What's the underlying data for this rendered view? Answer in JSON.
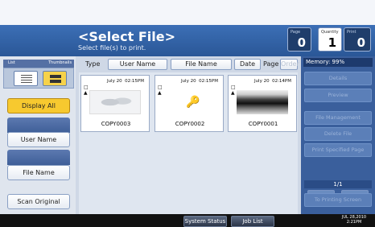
{
  "header": {
    "title": "<Select File>",
    "subtitle": "Select file(s) to print."
  },
  "counters": [
    {
      "label": "Page",
      "value": "0"
    },
    {
      "label": "Quantity",
      "value": "1"
    },
    {
      "label": "Print",
      "value": "0"
    }
  ],
  "view": {
    "list_label": "List",
    "thumbnails_label": "Thumbnails"
  },
  "sidebar": {
    "display_all": "Display All",
    "user_name": "User Name",
    "file_name": "File Name",
    "scan_original": "Scan Original"
  },
  "sortbar": {
    "type_label": "Type",
    "user_name": "User Name",
    "file_name": "File Name",
    "date": "Date",
    "page_label": "Page",
    "order": "Order"
  },
  "files": [
    {
      "date": "July 20",
      "time": "02:15PM",
      "name": "COPY0003",
      "thumb": "map"
    },
    {
      "date": "July 20",
      "time": "02:15PM",
      "name": "COPY0002",
      "thumb": "locked"
    },
    {
      "date": "July 20",
      "time": "02:14PM",
      "name": "COPY0001",
      "thumb": "photo"
    }
  ],
  "right": {
    "memory": "Memory: 99%",
    "details": "Details",
    "preview": "Preview",
    "file_management": "File Management",
    "delete_file": "Delete File",
    "print_specified_page": "Print Specified Page",
    "page_indicator": "1/1",
    "up": "▲",
    "down": "▼",
    "to_printing_screen": "To Printing Screen"
  },
  "status": {
    "system_status": "System Status",
    "job_list": "Job List",
    "date": "JUL  28,2010",
    "time": "2:21PM"
  },
  "colors": {
    "accent": "#f7c92f",
    "header_blue": "#2a5797"
  }
}
